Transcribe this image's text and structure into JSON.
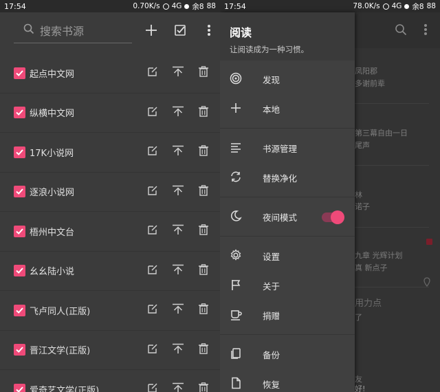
{
  "left": {
    "status": {
      "time": "17:54",
      "speed": "0.70K/s",
      "network": "4G",
      "battery": "88",
      "carrier": "余8"
    },
    "search": {
      "placeholder": "搜索书源"
    },
    "sources": [
      {
        "name": "起点中文网",
        "checked": true
      },
      {
        "name": "纵横中文网",
        "checked": true
      },
      {
        "name": "17K小说网",
        "checked": true
      },
      {
        "name": "逐浪小说网",
        "checked": true
      },
      {
        "name": "梧州中文台",
        "checked": true
      },
      {
        "name": "幺幺陆小说",
        "checked": true
      },
      {
        "name": "飞卢同人(正版)",
        "checked": true
      },
      {
        "name": "晋江文学(正版)",
        "checked": true
      },
      {
        "name": "爱奇艺文学(正版)",
        "checked": true
      }
    ]
  },
  "right": {
    "status": {
      "time": "17:54",
      "speed": "78.0K/s",
      "network": "4G",
      "battery": "88",
      "carrier": "余8"
    },
    "drawer": {
      "title": "阅读",
      "subtitle": "让阅读成为一种习惯。",
      "items": {
        "discover": "发现",
        "local": "本地",
        "source_manage": "书源管理",
        "replace": "替换净化",
        "night": "夜间模式",
        "settings": "设置",
        "about": "关于",
        "donate": "捐赠",
        "backup": "备份",
        "restore": "恢复"
      },
      "night_mode_on": true
    },
    "background_text": [
      "凤阳郡",
      "多谢前辈",
      "第三幕自由一日",
      "尾声",
      "林",
      "诺子",
      "九章 光辉计划",
      "真 新点子",
      "用力点",
      "了",
      "友",
      "好!"
    ]
  },
  "colors": {
    "accent": "#ef4a79"
  }
}
